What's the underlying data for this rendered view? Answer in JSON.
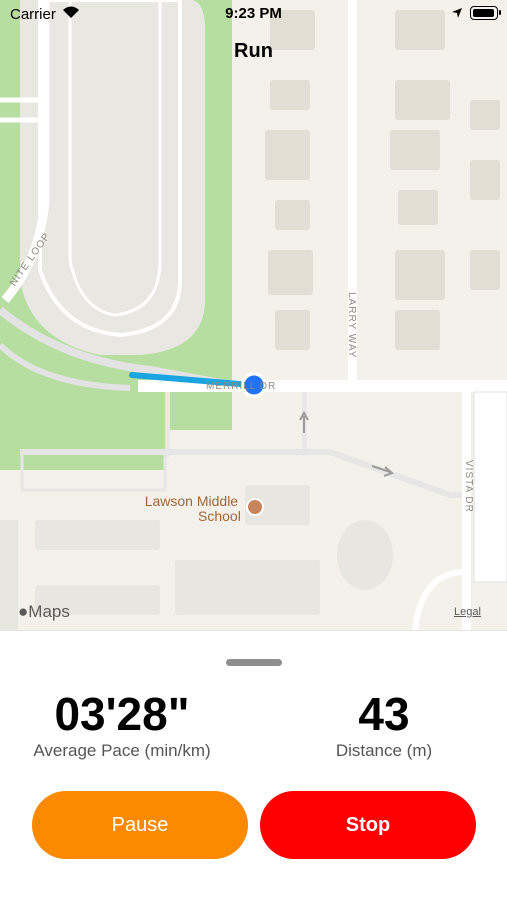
{
  "status_bar": {
    "carrier": "Carrier",
    "time": "9:23 PM"
  },
  "nav": {
    "title": "Run"
  },
  "map": {
    "streets": {
      "merrill": "MERRILL DR",
      "larry_way": "LARRY WAY",
      "vista_dr": "VISTA DR",
      "loop": "NITE LOOP"
    },
    "poi": {
      "line1": "Lawson Middle",
      "line2": "School"
    },
    "attribution": "Maps",
    "legal": "Legal",
    "colors": {
      "route": "#1aa4e2",
      "location_dot": "#1f73ff",
      "park": "#b7dea1"
    }
  },
  "stats": {
    "pace": {
      "value": "03'28\"",
      "label": "Average Pace (min/km)"
    },
    "distance": {
      "value": "43",
      "label": "Distance (m)"
    }
  },
  "controls": {
    "pause_label": "Pause",
    "stop_label": "Stop",
    "colors": {
      "pause": "#fb8a00",
      "stop": "#ff0000"
    }
  }
}
